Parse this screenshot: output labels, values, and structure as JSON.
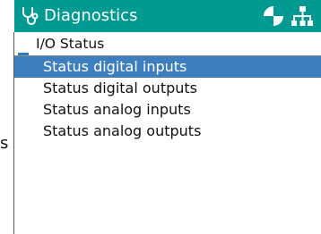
{
  "header": {
    "title": "Diagnostics",
    "background": "#009a93",
    "app_icon": "stethoscope-icon",
    "status_icons": [
      "quadrant-status-icon",
      "network-icon"
    ]
  },
  "subheader": {
    "label": "I/O Status"
  },
  "menu": {
    "selected_color": "#3d7fbe",
    "items": [
      {
        "label": "Status digital inputs",
        "selected": true
      },
      {
        "label": "Status digital outputs",
        "selected": false
      },
      {
        "label": "Status analog inputs",
        "selected": false
      },
      {
        "label": "Status analog outputs",
        "selected": false
      }
    ]
  },
  "side_text": "s"
}
